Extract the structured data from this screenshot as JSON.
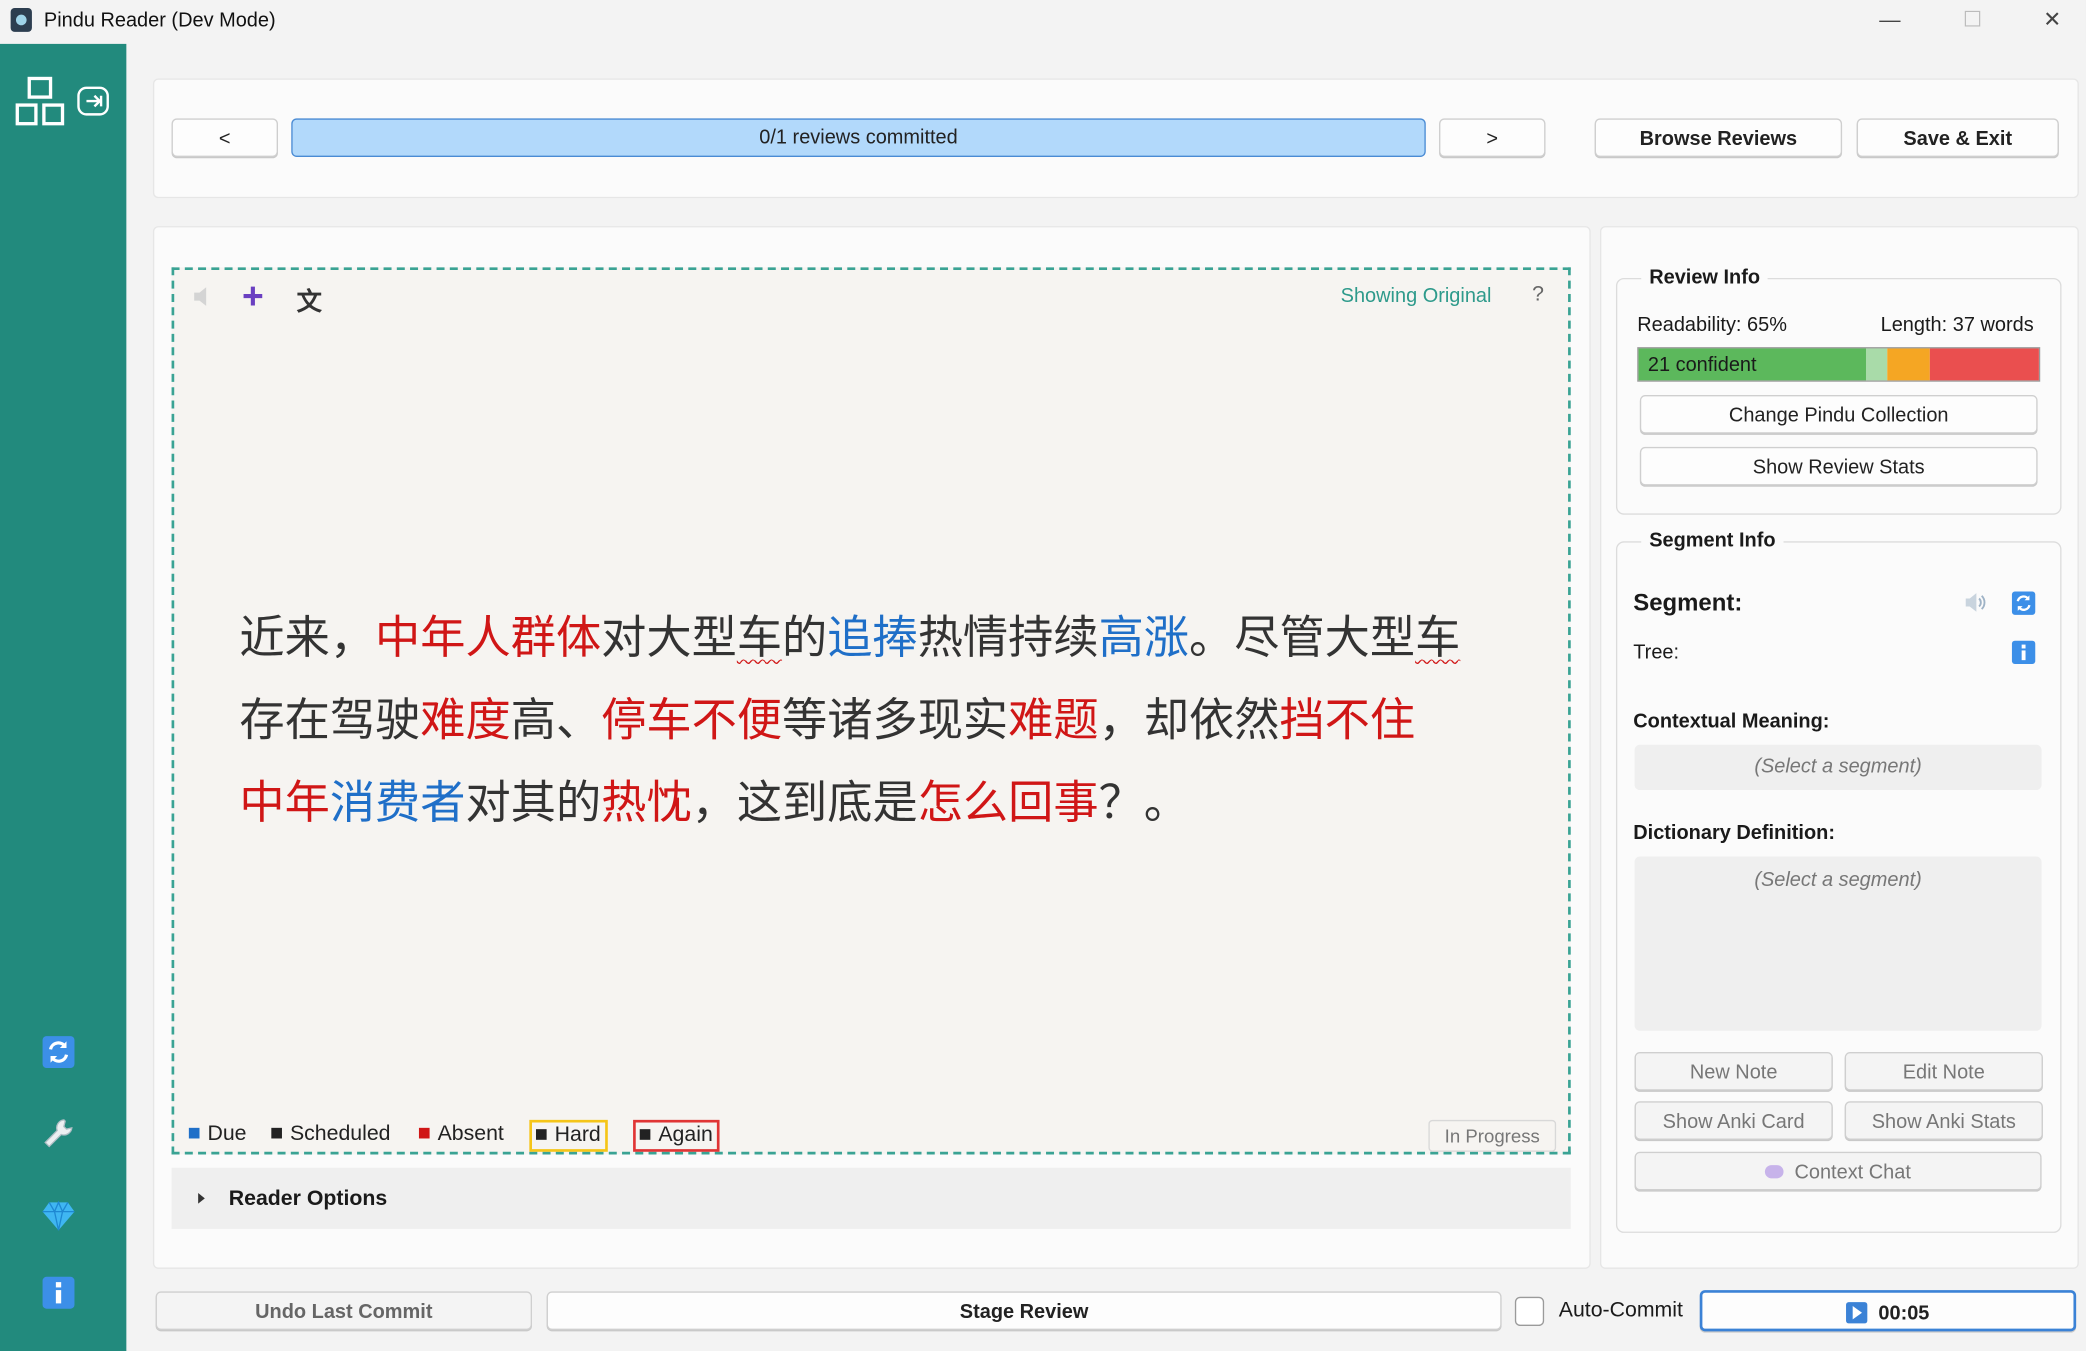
{
  "window": {
    "title": "Pindu Reader (Dev Mode)",
    "minimize": "—",
    "maximize": "☐",
    "close": "✕"
  },
  "sidebar": {
    "top_icons": [
      "dashboard-icon",
      "sidebar-toggle-icon"
    ],
    "bottom_icons": [
      "sync-icon",
      "wrench-icon",
      "gem-icon",
      "info-icon"
    ]
  },
  "topbar": {
    "prev_label": "<",
    "next_label": ">",
    "progress_text": "0/1 reviews committed",
    "browse_label": "Browse Reviews",
    "save_exit_label": "Save & Exit"
  },
  "reader": {
    "toolbar": {
      "speaker_icon": "speaker-icon",
      "add_icon": "+",
      "translate_icon": "文",
      "mode_text": "Showing Original",
      "help": "?"
    },
    "lines": [
      [
        {
          "t": "近来，",
          "c": "n"
        },
        {
          "t": "中年人群体",
          "c": "red"
        },
        {
          "t": "对大型",
          "c": "n"
        },
        {
          "t": "车",
          "c": "under"
        },
        {
          "t": "的",
          "c": "n"
        },
        {
          "t": "追捧",
          "c": "blue"
        },
        {
          "t": "热情持续",
          "c": "n"
        },
        {
          "t": "高涨",
          "c": "blue"
        },
        {
          "t": "。尽管大型",
          "c": "n"
        },
        {
          "t": "车",
          "c": "under"
        }
      ],
      [
        {
          "t": "存在驾驶",
          "c": "n"
        },
        {
          "t": "难度",
          "c": "red"
        },
        {
          "t": "高、",
          "c": "n"
        },
        {
          "t": "停车不便",
          "c": "red"
        },
        {
          "t": "等诸多现实",
          "c": "n"
        },
        {
          "t": "难题",
          "c": "red"
        },
        {
          "t": "，却依然",
          "c": "n"
        },
        {
          "t": "挡不住",
          "c": "red"
        }
      ],
      [
        {
          "t": "中年",
          "c": "red"
        },
        {
          "t": "消费者",
          "c": "blue"
        },
        {
          "t": "对其的",
          "c": "n"
        },
        {
          "t": "热忱",
          "c": "red"
        },
        {
          "t": "，这到底是",
          "c": "n"
        },
        {
          "t": "怎么回事",
          "c": "red"
        },
        {
          "t": "？。",
          "c": "n"
        }
      ]
    ],
    "legend": {
      "due": "Due",
      "scheduled": "Scheduled",
      "absent": "Absent",
      "hard": "Hard",
      "again": "Again"
    },
    "status_badge": "In Progress",
    "options_label": "Reader Options"
  },
  "review_info": {
    "title": "Review Info",
    "readability": "Readability: 65%",
    "length": "Length: 37 words",
    "confident_text": "21 confident",
    "colors": {
      "confident": "#5cb85c",
      "light": "#a9dba9",
      "orange": "#f5a623",
      "red": "#ea4f4f"
    },
    "change_collection": "Change Pindu Collection",
    "show_stats": "Show Review Stats"
  },
  "segment_info": {
    "title": "Segment Info",
    "segment_label": "Segment:",
    "tree_label": "Tree:",
    "contextual_label": "Contextual Meaning:",
    "contextual_placeholder": "(Select a segment)",
    "dictionary_label": "Dictionary Definition:",
    "dictionary_placeholder": "(Select a segment)",
    "new_note": "New Note",
    "edit_note": "Edit Note",
    "show_anki_card": "Show Anki Card",
    "show_anki_stats": "Show Anki Stats",
    "context_chat": "Context Chat"
  },
  "bottombar": {
    "undo_label": "Undo Last Commit",
    "stage_label": "Stage Review",
    "auto_commit_label": "Auto-Commit",
    "timer": "00:05"
  }
}
